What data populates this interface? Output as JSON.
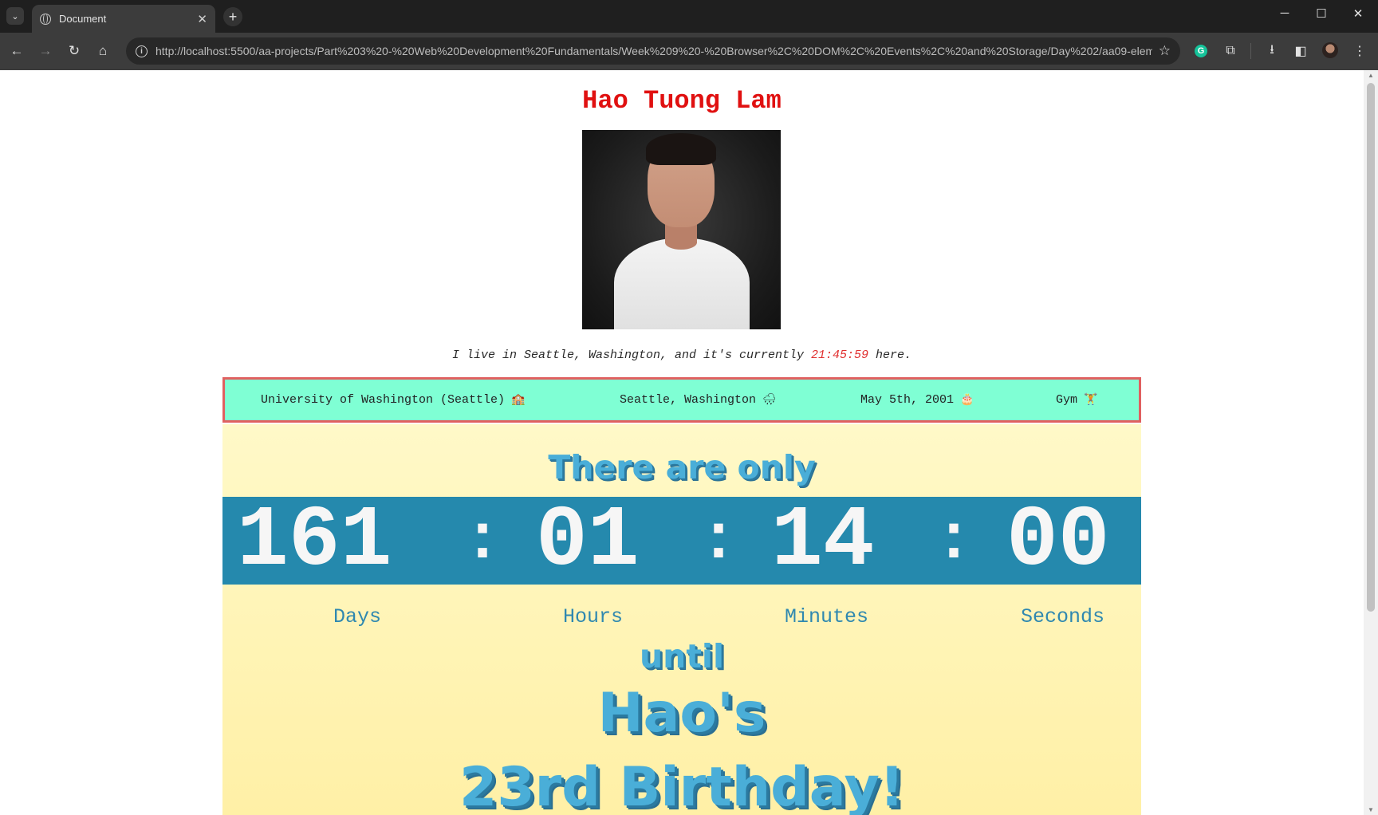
{
  "browser": {
    "tab_title": "Document",
    "tab_close": "✕",
    "new_tab": "+",
    "url": "http://localhost:5500/aa-projects/Part%203%20-%20Web%20Development%20Fundamentals/Week%209%20-%20Browser%2C%20DOM%2C%20Events%2C%20and%20Storage/Day%202/aa09-elemen...",
    "controls": {
      "minimize": "─",
      "maximize": "☐",
      "close": "✕"
    }
  },
  "profile": {
    "name": "Hao Tuong Lam",
    "intro_prefix": "I live in Seattle, Washington, and it's currently ",
    "local_time": "21:45:59",
    "intro_suffix": " here."
  },
  "facts": [
    {
      "text": "University of Washington (Seattle)",
      "emoji": "🏫"
    },
    {
      "text": "Seattle, Washington",
      "emoji": "🌧"
    },
    {
      "text": "May 5th, 2001",
      "emoji": "🎂"
    },
    {
      "text": "Gym",
      "emoji": "🏋"
    }
  ],
  "countdown": {
    "lead": "There are only",
    "days": "161",
    "hours": "01",
    "minutes": "14",
    "seconds": "00",
    "separator": ":",
    "labels": {
      "days": "Days",
      "hours": "Hours",
      "minutes": "Minutes",
      "seconds": "Seconds"
    },
    "until": "until",
    "event_line1": "Hao's",
    "event_line2": "23rd Birthday!"
  },
  "colors": {
    "name": "#e01010",
    "facts_bg": "#7fffd4",
    "facts_border": "#e06060",
    "band": "#2589ad",
    "headline": "#4aaed8"
  }
}
